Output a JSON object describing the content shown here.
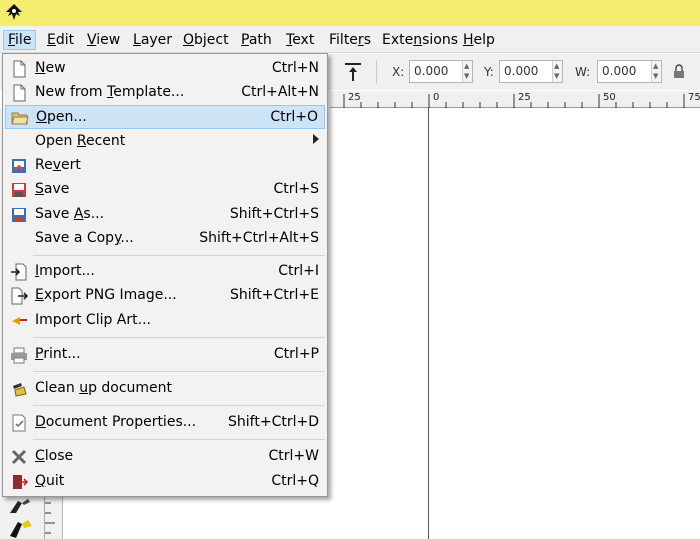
{
  "menubar": {
    "items": [
      {
        "pre": "",
        "key": "F",
        "post": "ile"
      },
      {
        "pre": "",
        "key": "E",
        "post": "dit"
      },
      {
        "pre": "",
        "key": "V",
        "post": "iew"
      },
      {
        "pre": "",
        "key": "L",
        "post": "ayer"
      },
      {
        "pre": "",
        "key": "O",
        "post": "bject"
      },
      {
        "pre": "",
        "key": "P",
        "post": "ath"
      },
      {
        "pre": "",
        "key": "T",
        "post": "ext"
      },
      {
        "pre": "Filte",
        "key": "r",
        "post": "s"
      },
      {
        "pre": "Exte",
        "key": "n",
        "post": "sions"
      },
      {
        "pre": "",
        "key": "H",
        "post": "elp"
      }
    ]
  },
  "toolbar": {
    "x_label": "X:",
    "x_value": "0.000",
    "y_label": "Y:",
    "y_value": "0.000",
    "w_label": "W:",
    "w_value": "0.000"
  },
  "ruler": {
    "ticks": [
      "25",
      "0",
      "25",
      "50",
      "75"
    ]
  },
  "file_menu": {
    "new": {
      "pre": "",
      "key": "N",
      "post": "ew",
      "shortcut": "Ctrl+N",
      "icon": "new-document-icon"
    },
    "new_template": {
      "pre": "New from ",
      "key": "T",
      "post": "emplate...",
      "shortcut": "Ctrl+Alt+N",
      "icon": "template-document-icon"
    },
    "open": {
      "pre": "",
      "key": "O",
      "post": "pen...",
      "shortcut": "Ctrl+O",
      "icon": "open-folder-icon"
    },
    "open_recent": {
      "pre": "Open ",
      "key": "R",
      "post": "ecent",
      "shortcut": "",
      "icon": ""
    },
    "revert": {
      "pre": "Re",
      "key": "v",
      "post": "ert",
      "shortcut": "",
      "icon": "revert-icon"
    },
    "save": {
      "pre": "",
      "key": "S",
      "post": "ave",
      "shortcut": "Ctrl+S",
      "icon": "save-icon"
    },
    "save_as": {
      "pre": "Save ",
      "key": "A",
      "post": "s...",
      "shortcut": "Shift+Ctrl+S",
      "icon": "save-as-icon"
    },
    "save_copy": {
      "pre": "Save a Cop",
      "key": "y",
      "post": "...",
      "shortcut": "Shift+Ctrl+Alt+S",
      "icon": ""
    },
    "import": {
      "pre": "",
      "key": "I",
      "post": "mport...",
      "shortcut": "Ctrl+I",
      "icon": "import-icon"
    },
    "export_png": {
      "pre": "",
      "key": "E",
      "post": "xport PNG Image...",
      "shortcut": "Shift+Ctrl+E",
      "icon": "export-icon"
    },
    "import_clip": {
      "pre": "Import Clip Art...",
      "key": "",
      "post": "",
      "shortcut": "",
      "icon": "clip-art-icon"
    },
    "print": {
      "pre": "",
      "key": "P",
      "post": "rint...",
      "shortcut": "Ctrl+P",
      "icon": "printer-icon"
    },
    "cleanup": {
      "pre": "Clean ",
      "key": "u",
      "post": "p document",
      "shortcut": "",
      "icon": "cleanup-broom-icon"
    },
    "doc_props": {
      "pre": "",
      "key": "D",
      "post": "ocument Properties...",
      "shortcut": "Shift+Ctrl+D",
      "icon": "properties-icon"
    },
    "close": {
      "pre": "",
      "key": "C",
      "post": "lose",
      "shortcut": "Ctrl+W",
      "icon": "close-x-icon"
    },
    "quit": {
      "pre": "",
      "key": "Q",
      "post": "uit",
      "shortcut": "Ctrl+Q",
      "icon": "quit-icon"
    }
  },
  "colors": {
    "titlebar": "#f4ec6c",
    "highlight": "#cde4f7",
    "menu_bg": "#f2f2f2"
  }
}
